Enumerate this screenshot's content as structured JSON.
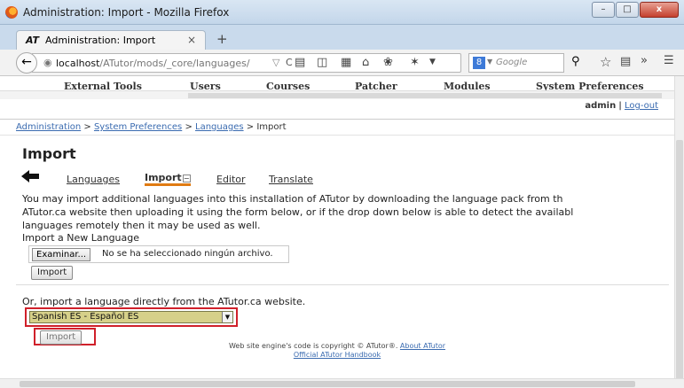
{
  "window": {
    "title": "Administration: Import - Mozilla Firefox",
    "minimize": "–",
    "maximize": "□",
    "close": "x"
  },
  "tab": {
    "icon_text": "AT",
    "label": "Administration: Import",
    "close": "×",
    "new_tab": "+"
  },
  "navbar": {
    "back": "←",
    "url_host": "localhost",
    "url_path": "/ATutor/mods/_core/languages/",
    "url_dropdown": "▽",
    "reload": "C",
    "search_engine": "8",
    "search_placeholder": "Google"
  },
  "topnav": {
    "items": [
      "External Tools",
      "Users",
      "Courses",
      "Patcher",
      "Modules",
      "System Preferences"
    ]
  },
  "user": {
    "name": "admin",
    "separator": "|",
    "logout": "Log-out"
  },
  "breadcrumb": {
    "crumb1": "Administration",
    "sep": ">",
    "crumb2": "System Preferences",
    "crumb3": "Languages",
    "current": "Import"
  },
  "page": {
    "title": "Import",
    "subnav": [
      "Languages",
      "Import",
      "Editor",
      "Translate"
    ],
    "subnav_toggle": "−",
    "intro_lines": [
      "You may import additional languages into this installation of ATutor by downloading the language pack from th",
      "ATutor.ca website then uploading it using the form below, or if the drop down below is able to detect the availabl",
      "languages remotely then it may be used as well."
    ],
    "import_new_label": "Import a New Language",
    "browse_button": "Examinar...",
    "file_status": "No se ha seleccionado ningún archivo.",
    "import_button": "Import",
    "direct_label": "Or, import a language directly from the ATutor.ca website.",
    "language_selected": "Spanish ES - Español ES",
    "import_button2": "Import"
  },
  "footer": {
    "copyright": "Web site engine's code is copyright © ATutor®.",
    "about": "About ATutor",
    "handbook": "Official ATutor Handbook"
  },
  "colors": {
    "highlight": "#d0202a",
    "active_tab_underline": "#e07b12",
    "select_bg": "#d6d089",
    "link": "#3a6bb0"
  }
}
